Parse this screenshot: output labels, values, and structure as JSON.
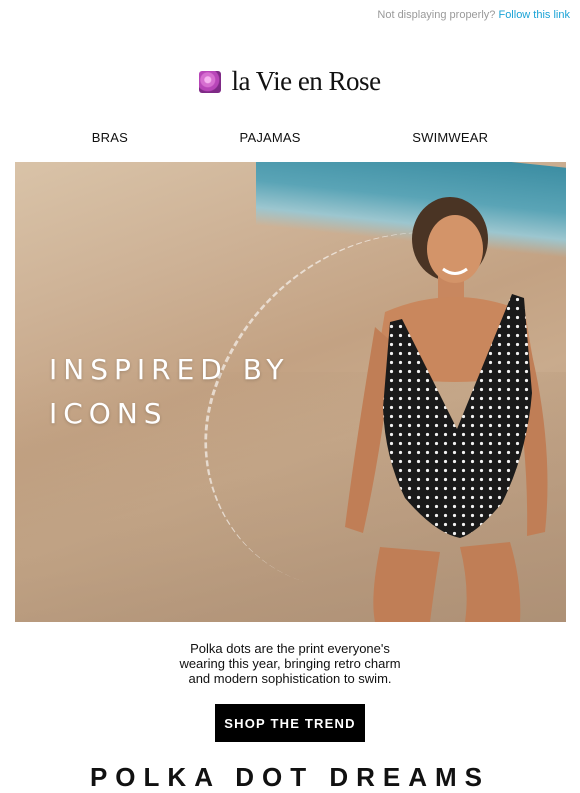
{
  "preheader": {
    "text": "Not displaying properly?",
    "link": "Follow this link"
  },
  "brand": {
    "name": "la Vie en Rose",
    "logo_icon": "rose-icon"
  },
  "nav": {
    "items": [
      "BRAS",
      "PAJAMAS",
      "SWIMWEAR"
    ]
  },
  "hero": {
    "headline_line1": "INSPIRED BY",
    "headline_line2": "ICONS",
    "image": "woman-in-polka-dot-swimsuit-on-beach"
  },
  "body": {
    "line1": "Polka dots are the print everyone's",
    "line2": "wearing this year, bringing retro charm",
    "line3": "and modern sophistication to swim."
  },
  "cta": {
    "label": "SHOP THE TREND"
  },
  "next_section": {
    "title": "POLKA DOT DREAMS"
  },
  "colors": {
    "link": "#1aa3d6",
    "cta_bg": "#000000",
    "text": "#111111"
  }
}
